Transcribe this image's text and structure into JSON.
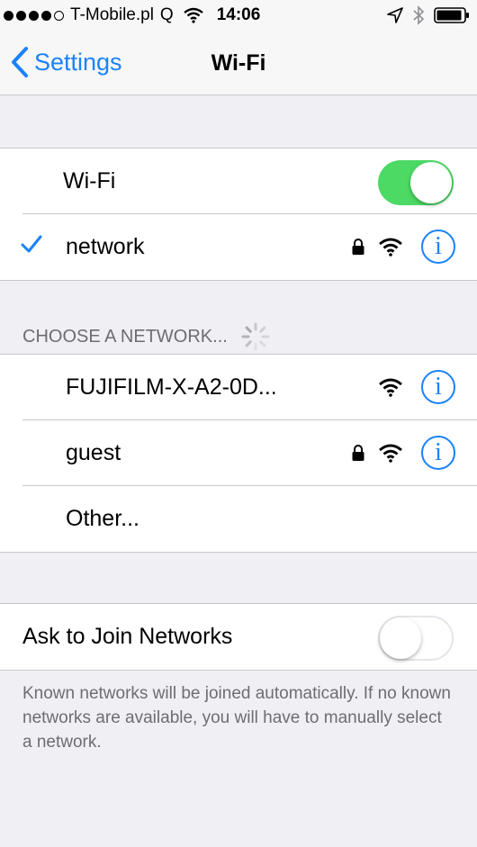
{
  "status_bar": {
    "carrier": "T-Mobile.pl",
    "carrier_suffix": "Q",
    "time": "14:06"
  },
  "nav": {
    "back_label": "Settings",
    "title": "Wi-Fi"
  },
  "wifi_toggle": {
    "label": "Wi-Fi",
    "on": true
  },
  "connected_network": {
    "name": "network",
    "secured": true
  },
  "choose_header": "CHOOSE A NETWORK...",
  "networks": [
    {
      "name": "FUJIFILM-X-A2-0D...",
      "secured": false
    },
    {
      "name": "guest",
      "secured": true
    }
  ],
  "other_label": "Other...",
  "ask_to_join": {
    "label": "Ask to Join Networks",
    "on": false
  },
  "footer_note": "Known networks will be joined automatically. If no known networks are available, you will have to manually select a network.",
  "colors": {
    "accent": "#1a82fb",
    "toggle_on": "#4cd964",
    "background": "#efeff4"
  }
}
